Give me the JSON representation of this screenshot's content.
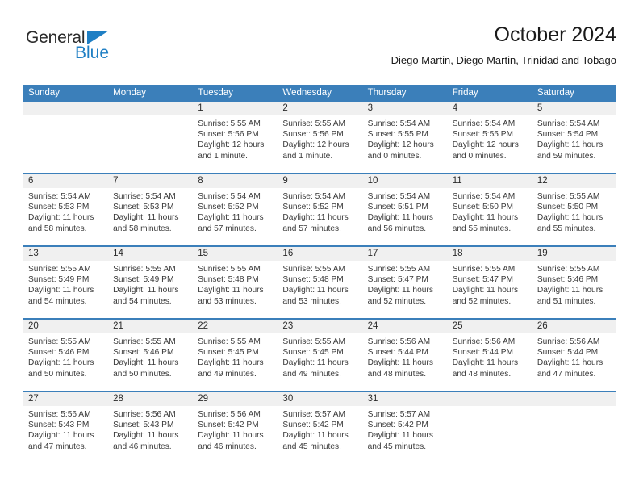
{
  "logo": {
    "text_top": "General",
    "text_bottom": "Blue",
    "triangle_icon": "triangle-icon",
    "color_dark": "#2b2b2b",
    "color_blue": "#1f7fc4"
  },
  "header": {
    "month_title": "October 2024",
    "location": "Diego Martin, Diego Martin, Trinidad and Tobago"
  },
  "colors": {
    "header_blue": "#3b7fba",
    "day_band_gray": "#f0f0f0",
    "text_dark": "#2b2b2b",
    "body_text": "#3a3a3a"
  },
  "weekdays": [
    "Sunday",
    "Monday",
    "Tuesday",
    "Wednesday",
    "Thursday",
    "Friday",
    "Saturday"
  ],
  "weeks": [
    [
      {
        "day": "",
        "lines": []
      },
      {
        "day": "",
        "lines": []
      },
      {
        "day": "1",
        "lines": [
          "Sunrise: 5:55 AM",
          "Sunset: 5:56 PM",
          "Daylight: 12 hours",
          "and 1 minute."
        ]
      },
      {
        "day": "2",
        "lines": [
          "Sunrise: 5:55 AM",
          "Sunset: 5:56 PM",
          "Daylight: 12 hours",
          "and 1 minute."
        ]
      },
      {
        "day": "3",
        "lines": [
          "Sunrise: 5:54 AM",
          "Sunset: 5:55 PM",
          "Daylight: 12 hours",
          "and 0 minutes."
        ]
      },
      {
        "day": "4",
        "lines": [
          "Sunrise: 5:54 AM",
          "Sunset: 5:55 PM",
          "Daylight: 12 hours",
          "and 0 minutes."
        ]
      },
      {
        "day": "5",
        "lines": [
          "Sunrise: 5:54 AM",
          "Sunset: 5:54 PM",
          "Daylight: 11 hours",
          "and 59 minutes."
        ]
      }
    ],
    [
      {
        "day": "6",
        "lines": [
          "Sunrise: 5:54 AM",
          "Sunset: 5:53 PM",
          "Daylight: 11 hours",
          "and 58 minutes."
        ]
      },
      {
        "day": "7",
        "lines": [
          "Sunrise: 5:54 AM",
          "Sunset: 5:53 PM",
          "Daylight: 11 hours",
          "and 58 minutes."
        ]
      },
      {
        "day": "8",
        "lines": [
          "Sunrise: 5:54 AM",
          "Sunset: 5:52 PM",
          "Daylight: 11 hours",
          "and 57 minutes."
        ]
      },
      {
        "day": "9",
        "lines": [
          "Sunrise: 5:54 AM",
          "Sunset: 5:52 PM",
          "Daylight: 11 hours",
          "and 57 minutes."
        ]
      },
      {
        "day": "10",
        "lines": [
          "Sunrise: 5:54 AM",
          "Sunset: 5:51 PM",
          "Daylight: 11 hours",
          "and 56 minutes."
        ]
      },
      {
        "day": "11",
        "lines": [
          "Sunrise: 5:54 AM",
          "Sunset: 5:50 PM",
          "Daylight: 11 hours",
          "and 55 minutes."
        ]
      },
      {
        "day": "12",
        "lines": [
          "Sunrise: 5:55 AM",
          "Sunset: 5:50 PM",
          "Daylight: 11 hours",
          "and 55 minutes."
        ]
      }
    ],
    [
      {
        "day": "13",
        "lines": [
          "Sunrise: 5:55 AM",
          "Sunset: 5:49 PM",
          "Daylight: 11 hours",
          "and 54 minutes."
        ]
      },
      {
        "day": "14",
        "lines": [
          "Sunrise: 5:55 AM",
          "Sunset: 5:49 PM",
          "Daylight: 11 hours",
          "and 54 minutes."
        ]
      },
      {
        "day": "15",
        "lines": [
          "Sunrise: 5:55 AM",
          "Sunset: 5:48 PM",
          "Daylight: 11 hours",
          "and 53 minutes."
        ]
      },
      {
        "day": "16",
        "lines": [
          "Sunrise: 5:55 AM",
          "Sunset: 5:48 PM",
          "Daylight: 11 hours",
          "and 53 minutes."
        ]
      },
      {
        "day": "17",
        "lines": [
          "Sunrise: 5:55 AM",
          "Sunset: 5:47 PM",
          "Daylight: 11 hours",
          "and 52 minutes."
        ]
      },
      {
        "day": "18",
        "lines": [
          "Sunrise: 5:55 AM",
          "Sunset: 5:47 PM",
          "Daylight: 11 hours",
          "and 52 minutes."
        ]
      },
      {
        "day": "19",
        "lines": [
          "Sunrise: 5:55 AM",
          "Sunset: 5:46 PM",
          "Daylight: 11 hours",
          "and 51 minutes."
        ]
      }
    ],
    [
      {
        "day": "20",
        "lines": [
          "Sunrise: 5:55 AM",
          "Sunset: 5:46 PM",
          "Daylight: 11 hours",
          "and 50 minutes."
        ]
      },
      {
        "day": "21",
        "lines": [
          "Sunrise: 5:55 AM",
          "Sunset: 5:46 PM",
          "Daylight: 11 hours",
          "and 50 minutes."
        ]
      },
      {
        "day": "22",
        "lines": [
          "Sunrise: 5:55 AM",
          "Sunset: 5:45 PM",
          "Daylight: 11 hours",
          "and 49 minutes."
        ]
      },
      {
        "day": "23",
        "lines": [
          "Sunrise: 5:55 AM",
          "Sunset: 5:45 PM",
          "Daylight: 11 hours",
          "and 49 minutes."
        ]
      },
      {
        "day": "24",
        "lines": [
          "Sunrise: 5:56 AM",
          "Sunset: 5:44 PM",
          "Daylight: 11 hours",
          "and 48 minutes."
        ]
      },
      {
        "day": "25",
        "lines": [
          "Sunrise: 5:56 AM",
          "Sunset: 5:44 PM",
          "Daylight: 11 hours",
          "and 48 minutes."
        ]
      },
      {
        "day": "26",
        "lines": [
          "Sunrise: 5:56 AM",
          "Sunset: 5:44 PM",
          "Daylight: 11 hours",
          "and 47 minutes."
        ]
      }
    ],
    [
      {
        "day": "27",
        "lines": [
          "Sunrise: 5:56 AM",
          "Sunset: 5:43 PM",
          "Daylight: 11 hours",
          "and 47 minutes."
        ]
      },
      {
        "day": "28",
        "lines": [
          "Sunrise: 5:56 AM",
          "Sunset: 5:43 PM",
          "Daylight: 11 hours",
          "and 46 minutes."
        ]
      },
      {
        "day": "29",
        "lines": [
          "Sunrise: 5:56 AM",
          "Sunset: 5:42 PM",
          "Daylight: 11 hours",
          "and 46 minutes."
        ]
      },
      {
        "day": "30",
        "lines": [
          "Sunrise: 5:57 AM",
          "Sunset: 5:42 PM",
          "Daylight: 11 hours",
          "and 45 minutes."
        ]
      },
      {
        "day": "31",
        "lines": [
          "Sunrise: 5:57 AM",
          "Sunset: 5:42 PM",
          "Daylight: 11 hours",
          "and 45 minutes."
        ]
      },
      {
        "day": "",
        "lines": []
      },
      {
        "day": "",
        "lines": []
      }
    ]
  ]
}
